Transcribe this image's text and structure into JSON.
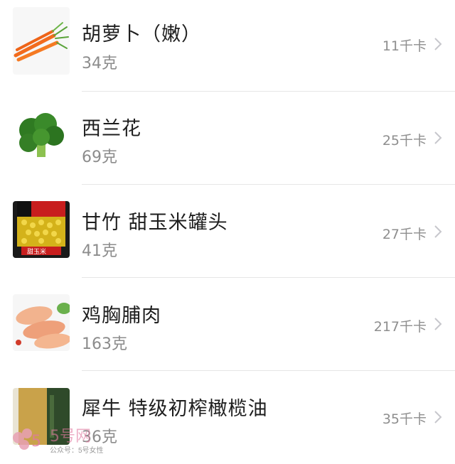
{
  "items": [
    {
      "name": "胡萝卜（嫩）",
      "amount": "34克",
      "calories": "11千卡",
      "icon": "carrot-icon"
    },
    {
      "name": "西兰花",
      "amount": "69克",
      "calories": "25千卡",
      "icon": "broccoli-icon"
    },
    {
      "name": "甘竹  甜玉米罐头",
      "amount": "41克",
      "calories": "27千卡",
      "icon": "corn-can-icon",
      "can_label": "甜玉米"
    },
    {
      "name": "鸡胸脯肉",
      "amount": "163克",
      "calories": "217千卡",
      "icon": "chicken-breast-icon"
    },
    {
      "name": "犀牛 特级初榨橄榄油",
      "amount": "36克",
      "calories": "35千卡",
      "icon": "olive-oil-icon"
    }
  ],
  "watermark": {
    "logo_text": "5号网",
    "caption": "公众号：5号女性"
  },
  "colors": {
    "text": "#1e1e1e",
    "secondary": "#8c8c8c",
    "divider": "#e6e6e6"
  }
}
